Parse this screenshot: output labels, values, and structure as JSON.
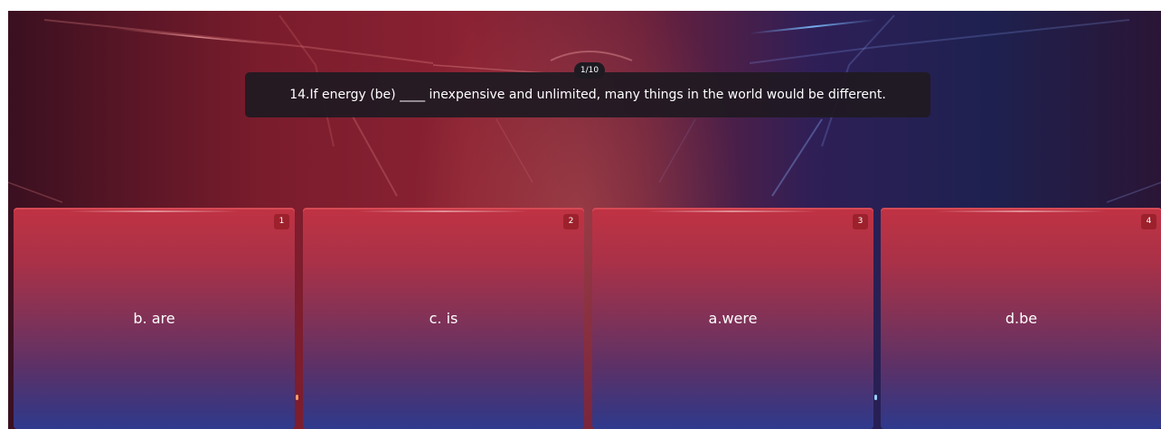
{
  "quiz": {
    "counter": "1/10",
    "question": "14.If energy (be) ____ inexpensive and unlimited, many things in the world would be different."
  },
  "answers": [
    {
      "number": "1",
      "label": "b. are"
    },
    {
      "number": "2",
      "label": "c. is"
    },
    {
      "number": "3",
      "label": "a.were"
    },
    {
      "number": "4",
      "label": "d.be"
    }
  ],
  "colors": {
    "card_top": "#c03243",
    "card_bottom": "#2f3a8d",
    "question_bg": "#201a22",
    "badge_bg": "#961e28"
  }
}
